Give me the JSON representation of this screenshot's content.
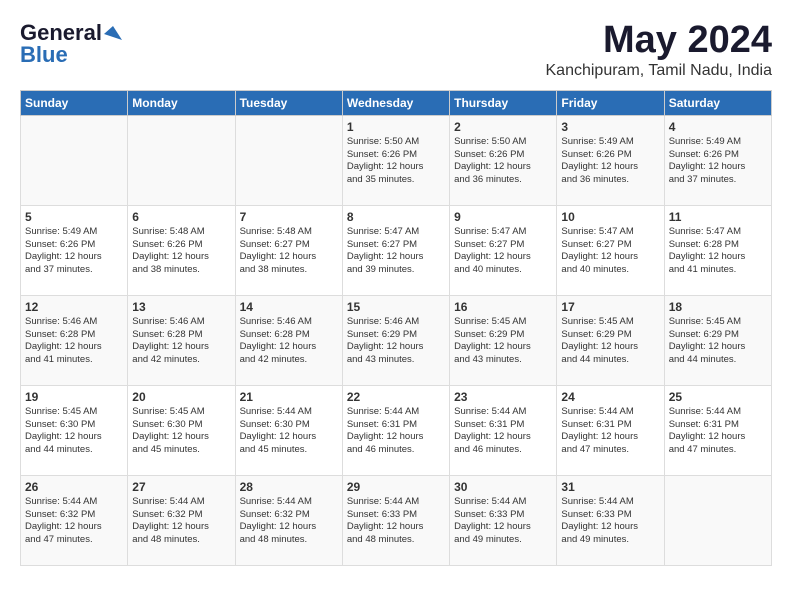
{
  "logo": {
    "general": "General",
    "blue": "Blue"
  },
  "title": "May 2024",
  "location": "Kanchipuram, Tamil Nadu, India",
  "days_of_week": [
    "Sunday",
    "Monday",
    "Tuesday",
    "Wednesday",
    "Thursday",
    "Friday",
    "Saturday"
  ],
  "weeks": [
    [
      {
        "day": "",
        "info": ""
      },
      {
        "day": "",
        "info": ""
      },
      {
        "day": "",
        "info": ""
      },
      {
        "day": "1",
        "info": "Sunrise: 5:50 AM\nSunset: 6:26 PM\nDaylight: 12 hours\nand 35 minutes."
      },
      {
        "day": "2",
        "info": "Sunrise: 5:50 AM\nSunset: 6:26 PM\nDaylight: 12 hours\nand 36 minutes."
      },
      {
        "day": "3",
        "info": "Sunrise: 5:49 AM\nSunset: 6:26 PM\nDaylight: 12 hours\nand 36 minutes."
      },
      {
        "day": "4",
        "info": "Sunrise: 5:49 AM\nSunset: 6:26 PM\nDaylight: 12 hours\nand 37 minutes."
      }
    ],
    [
      {
        "day": "5",
        "info": "Sunrise: 5:49 AM\nSunset: 6:26 PM\nDaylight: 12 hours\nand 37 minutes."
      },
      {
        "day": "6",
        "info": "Sunrise: 5:48 AM\nSunset: 6:26 PM\nDaylight: 12 hours\nand 38 minutes."
      },
      {
        "day": "7",
        "info": "Sunrise: 5:48 AM\nSunset: 6:27 PM\nDaylight: 12 hours\nand 38 minutes."
      },
      {
        "day": "8",
        "info": "Sunrise: 5:47 AM\nSunset: 6:27 PM\nDaylight: 12 hours\nand 39 minutes."
      },
      {
        "day": "9",
        "info": "Sunrise: 5:47 AM\nSunset: 6:27 PM\nDaylight: 12 hours\nand 40 minutes."
      },
      {
        "day": "10",
        "info": "Sunrise: 5:47 AM\nSunset: 6:27 PM\nDaylight: 12 hours\nand 40 minutes."
      },
      {
        "day": "11",
        "info": "Sunrise: 5:47 AM\nSunset: 6:28 PM\nDaylight: 12 hours\nand 41 minutes."
      }
    ],
    [
      {
        "day": "12",
        "info": "Sunrise: 5:46 AM\nSunset: 6:28 PM\nDaylight: 12 hours\nand 41 minutes."
      },
      {
        "day": "13",
        "info": "Sunrise: 5:46 AM\nSunset: 6:28 PM\nDaylight: 12 hours\nand 42 minutes."
      },
      {
        "day": "14",
        "info": "Sunrise: 5:46 AM\nSunset: 6:28 PM\nDaylight: 12 hours\nand 42 minutes."
      },
      {
        "day": "15",
        "info": "Sunrise: 5:46 AM\nSunset: 6:29 PM\nDaylight: 12 hours\nand 43 minutes."
      },
      {
        "day": "16",
        "info": "Sunrise: 5:45 AM\nSunset: 6:29 PM\nDaylight: 12 hours\nand 43 minutes."
      },
      {
        "day": "17",
        "info": "Sunrise: 5:45 AM\nSunset: 6:29 PM\nDaylight: 12 hours\nand 44 minutes."
      },
      {
        "day": "18",
        "info": "Sunrise: 5:45 AM\nSunset: 6:29 PM\nDaylight: 12 hours\nand 44 minutes."
      }
    ],
    [
      {
        "day": "19",
        "info": "Sunrise: 5:45 AM\nSunset: 6:30 PM\nDaylight: 12 hours\nand 44 minutes."
      },
      {
        "day": "20",
        "info": "Sunrise: 5:45 AM\nSunset: 6:30 PM\nDaylight: 12 hours\nand 45 minutes."
      },
      {
        "day": "21",
        "info": "Sunrise: 5:44 AM\nSunset: 6:30 PM\nDaylight: 12 hours\nand 45 minutes."
      },
      {
        "day": "22",
        "info": "Sunrise: 5:44 AM\nSunset: 6:31 PM\nDaylight: 12 hours\nand 46 minutes."
      },
      {
        "day": "23",
        "info": "Sunrise: 5:44 AM\nSunset: 6:31 PM\nDaylight: 12 hours\nand 46 minutes."
      },
      {
        "day": "24",
        "info": "Sunrise: 5:44 AM\nSunset: 6:31 PM\nDaylight: 12 hours\nand 47 minutes."
      },
      {
        "day": "25",
        "info": "Sunrise: 5:44 AM\nSunset: 6:31 PM\nDaylight: 12 hours\nand 47 minutes."
      }
    ],
    [
      {
        "day": "26",
        "info": "Sunrise: 5:44 AM\nSunset: 6:32 PM\nDaylight: 12 hours\nand 47 minutes."
      },
      {
        "day": "27",
        "info": "Sunrise: 5:44 AM\nSunset: 6:32 PM\nDaylight: 12 hours\nand 48 minutes."
      },
      {
        "day": "28",
        "info": "Sunrise: 5:44 AM\nSunset: 6:32 PM\nDaylight: 12 hours\nand 48 minutes."
      },
      {
        "day": "29",
        "info": "Sunrise: 5:44 AM\nSunset: 6:33 PM\nDaylight: 12 hours\nand 48 minutes."
      },
      {
        "day": "30",
        "info": "Sunrise: 5:44 AM\nSunset: 6:33 PM\nDaylight: 12 hours\nand 49 minutes."
      },
      {
        "day": "31",
        "info": "Sunrise: 5:44 AM\nSunset: 6:33 PM\nDaylight: 12 hours\nand 49 minutes."
      },
      {
        "day": "",
        "info": ""
      }
    ]
  ]
}
